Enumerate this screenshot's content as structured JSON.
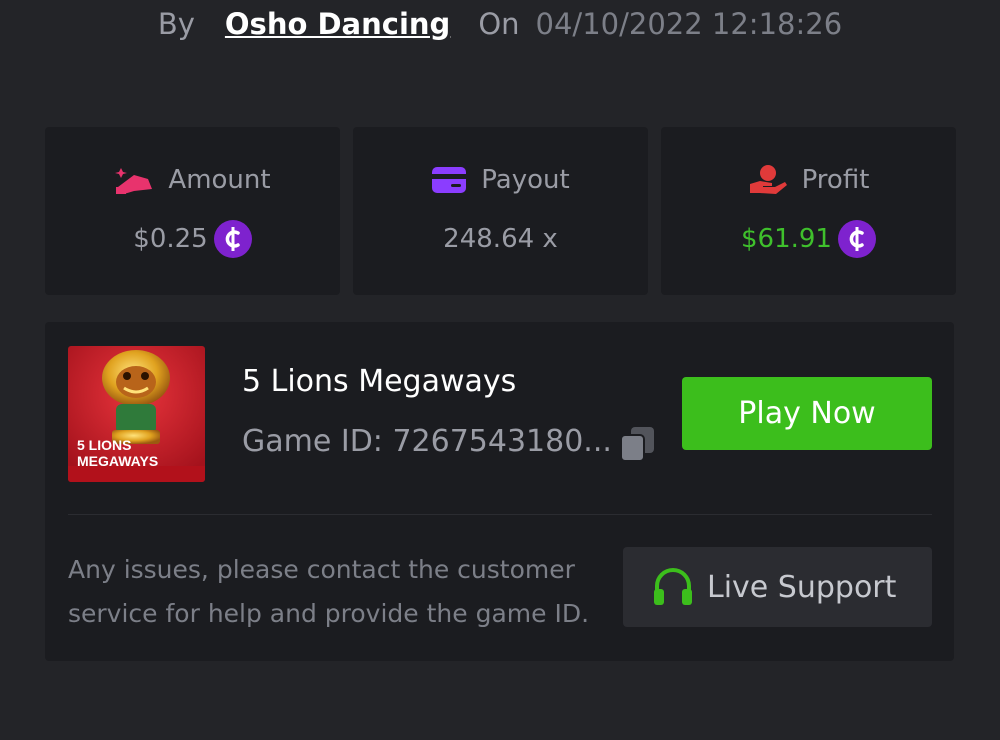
{
  "byline": {
    "by_label": "By",
    "username": "Osho Dancing",
    "on_label": "On",
    "datetime": "04/10/2022 12:18:26"
  },
  "stats": {
    "amount": {
      "label": "Amount",
      "value": "$0.25",
      "icon": "amount-icon",
      "icon_color": "#e8336d"
    },
    "payout": {
      "label": "Payout",
      "value": "248.64 x",
      "icon": "card-icon",
      "icon_color": "#8b3dff"
    },
    "profit": {
      "label": "Profit",
      "value": "$61.91",
      "icon": "hand-profit-icon",
      "icon_color": "#e03a3a",
      "value_color": "#3fc02c"
    }
  },
  "coin": {
    "glyph": "₵",
    "color": "#7e22ce"
  },
  "game": {
    "title": "5 Lions Megaways",
    "id_text": "Game ID: 7267543180...",
    "thumb_line1": "5 LIONS",
    "thumb_line2": "MEGAWAYS",
    "play_label": "Play Now",
    "play_color": "#3cbe1c"
  },
  "support": {
    "message": "Any issues, please contact the customer service for help and provide the game ID.",
    "button_label": "Live Support",
    "icon": "headset-icon",
    "icon_color": "#3cbe1c"
  }
}
